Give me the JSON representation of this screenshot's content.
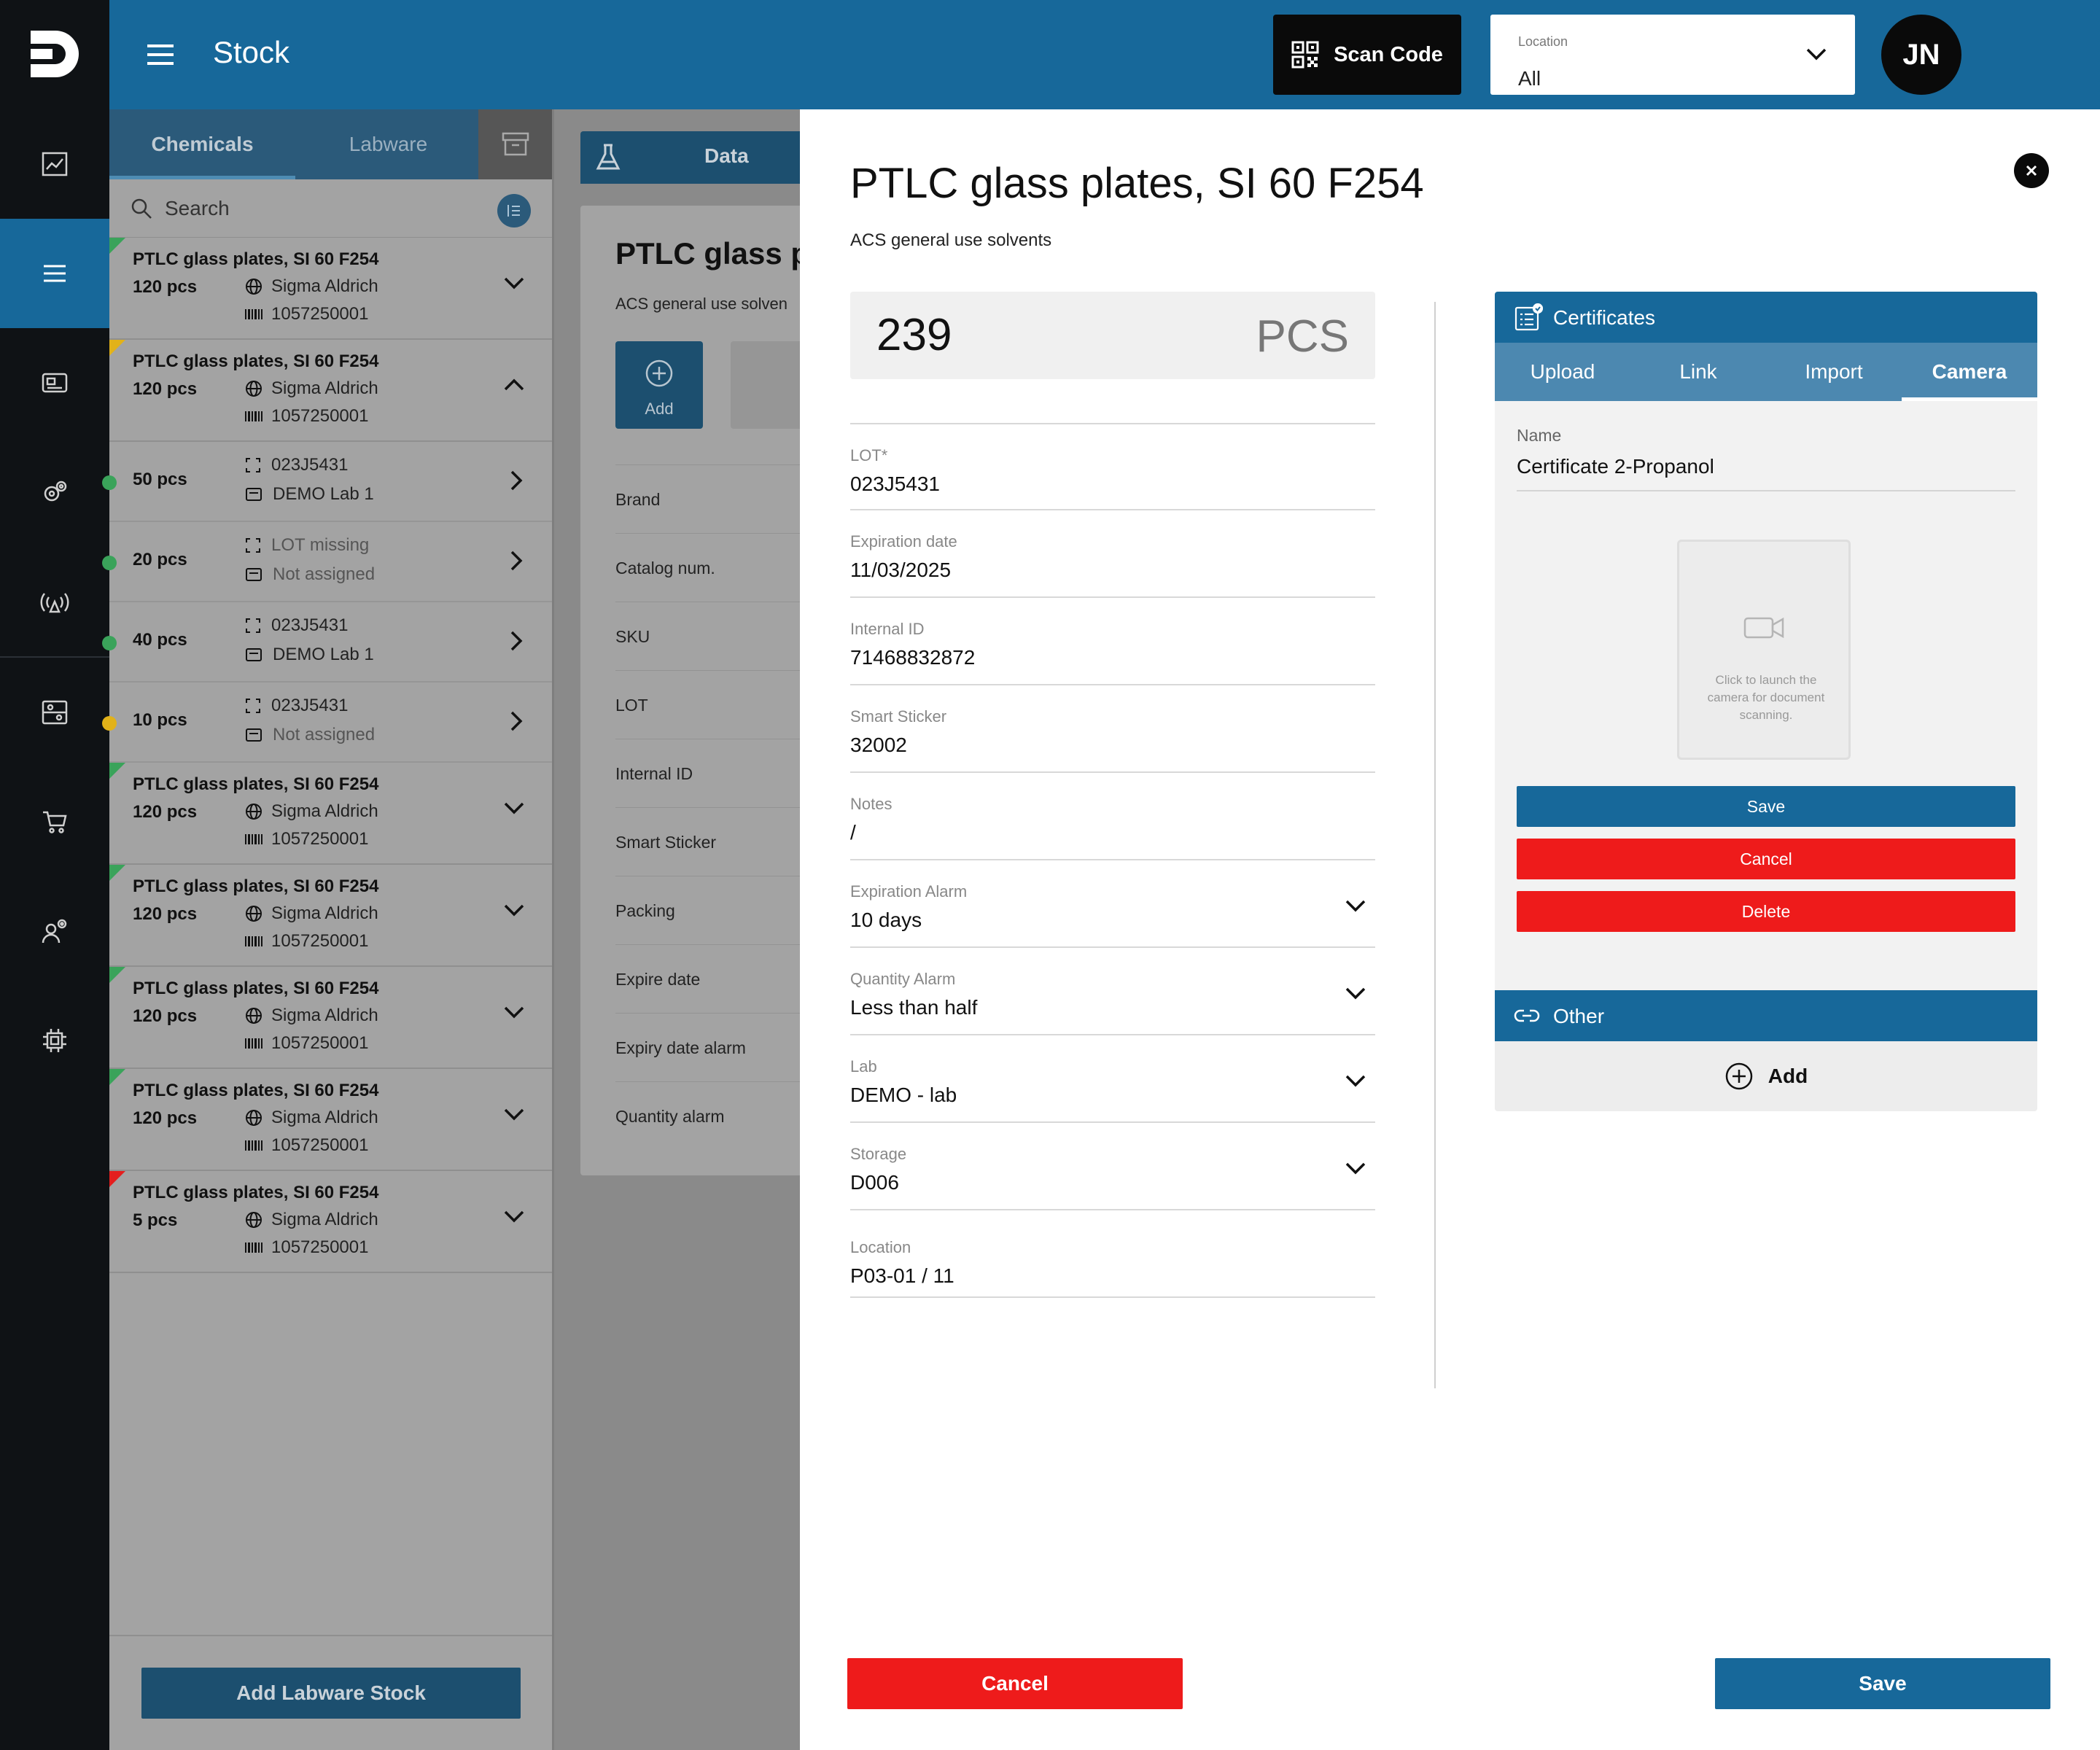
{
  "app": {
    "title": "Stock"
  },
  "topbar": {
    "scan_label": "Scan Code",
    "location_label": "Location",
    "location_value": "All",
    "avatar": "JN"
  },
  "left": {
    "tab_chemicals": "Chemicals",
    "tab_labware": "Labware",
    "search_placeholder": "Search",
    "items": [
      {
        "name": "PTLC glass plates, SI 60 F254",
        "qty": "120 pcs",
        "brand": "Sigma Aldrich",
        "cat": "1057250001",
        "flag": "#3aa35a"
      },
      {
        "name": "PTLC glass plates, SI 60 F254",
        "qty": "120 pcs",
        "brand": "Sigma Aldrich",
        "cat": "1057250001",
        "flag": "#e2b219"
      },
      {
        "name": "PTLC glass plates, SI 60 F254",
        "qty": "120 pcs",
        "brand": "Sigma Aldrich",
        "cat": "1057250001",
        "flag": "#3aa35a"
      },
      {
        "name": "PTLC glass plates, SI 60 F254",
        "qty": "120 pcs",
        "brand": "Sigma Aldrich",
        "cat": "1057250001",
        "flag": "#3aa35a"
      },
      {
        "name": "PTLC glass plates, SI 60 F254",
        "qty": "120 pcs",
        "brand": "Sigma Aldrich",
        "cat": "1057250001",
        "flag": "#3aa35a"
      },
      {
        "name": "PTLC glass plates, SI 60 F254",
        "qty": "120 pcs",
        "brand": "Sigma Aldrich",
        "cat": "1057250001",
        "flag": "#3aa35a"
      },
      {
        "name": "PTLC glass plates, SI 60 F254",
        "qty": "5 pcs",
        "brand": "Sigma Aldrich",
        "cat": "1057250001",
        "flag": "#e41e1e"
      }
    ],
    "subitems": [
      {
        "qty": "50 pcs",
        "lot": "023J5431",
        "lab": "DEMO Lab 1",
        "dot": "#3aa35a"
      },
      {
        "qty": "20 pcs",
        "lot": "LOT missing",
        "lab": "Not assigned",
        "dot": "#3aa35a"
      },
      {
        "qty": "40 pcs",
        "lot": "023J5431",
        "lab": "DEMO Lab 1",
        "dot": "#3aa35a"
      },
      {
        "qty": "10 pcs",
        "lot": "023J5431",
        "lab": "Not assigned",
        "dot": "#e2b219"
      }
    ],
    "add_button": "Add Labware Stock"
  },
  "middle": {
    "tab_label": "Data",
    "title": "PTLC glass p",
    "subtitle": "ACS general use solven",
    "add_label": "Add",
    "rows": [
      "Brand",
      "Catalog num.",
      "SKU",
      "LOT",
      "Internal ID",
      "Smart Sticker",
      "Packing",
      "Expire date",
      "Expiry date alarm",
      "Quantity alarm"
    ]
  },
  "drawer": {
    "title": "PTLC glass plates, SI 60 F254",
    "subtitle": "ACS general use solvents",
    "quantity": "239",
    "unit": "PCS",
    "fields": {
      "lot": {
        "label": "LOT*",
        "value": "023J5431"
      },
      "expiration": {
        "label": "Expiration date",
        "value": "11/03/2025"
      },
      "internal_id": {
        "label": "Internal ID",
        "value": "71468832872"
      },
      "smart_sticker": {
        "label": "Smart Sticker",
        "value": "32002"
      },
      "notes": {
        "label": "Notes",
        "value": "/"
      },
      "exp_alarm": {
        "label": "Expiration Alarm",
        "value": "10 days"
      },
      "qty_alarm": {
        "label": "Quantity Alarm",
        "value": "Less than half"
      },
      "lab": {
        "label": "Lab",
        "value": "DEMO - lab"
      },
      "storage": {
        "label": "Storage",
        "value": "D006"
      },
      "location": {
        "label": "Location",
        "value": "P03-01 / 11"
      }
    },
    "cancel_label": "Cancel",
    "save_label": "Save"
  },
  "certificates": {
    "title": "Certificates",
    "tabs": [
      "Upload",
      "Link",
      "Import",
      "Camera"
    ],
    "active_tab": "Camera",
    "name_label": "Name",
    "name_value": "Certificate 2-Propanol",
    "camera_hint": "Click to launch the camera for document scanning.",
    "save_label": "Save",
    "cancel_label": "Cancel",
    "delete_label": "Delete",
    "other_title": "Other",
    "add_label": "Add"
  },
  "colors": {
    "primary": "#17689a",
    "danger": "#ee1b1b",
    "dark": "#0f1215"
  }
}
